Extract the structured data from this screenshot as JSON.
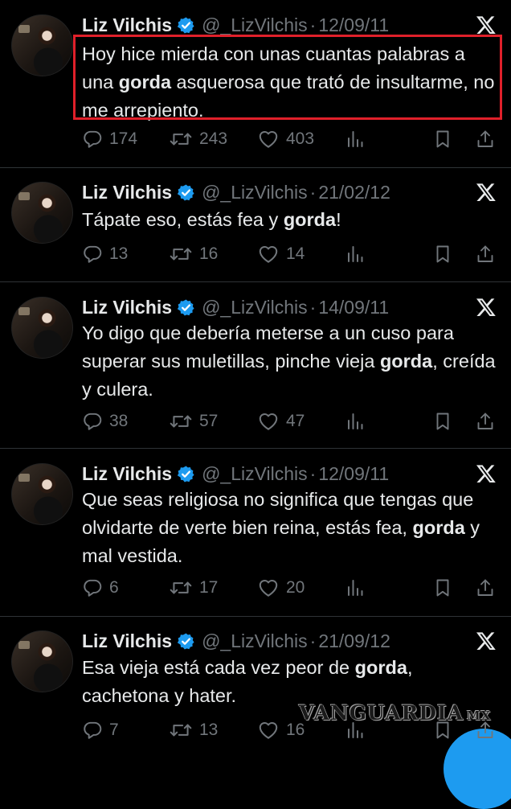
{
  "tweets": [
    {
      "name": "Liz Vilchis",
      "handle": "@_LizVilchis",
      "date": "12/09/11",
      "text": [
        {
          "t": "Hoy hice mierda con unas cuantas palabras a una "
        },
        {
          "t": "gorda",
          "b": true
        },
        {
          "t": " asquerosa que trató de insultarme, no me arrepiento."
        }
      ],
      "highlighted": true,
      "replies": "174",
      "retweets": "243",
      "likes": "403"
    },
    {
      "name": "Liz Vilchis",
      "handle": "@_LizVilchis",
      "date": "21/02/12",
      "text": [
        {
          "t": "Tápate eso, estás fea y "
        },
        {
          "t": "gorda",
          "b": true
        },
        {
          "t": "!"
        }
      ],
      "highlighted": false,
      "replies": "13",
      "retweets": "16",
      "likes": "14"
    },
    {
      "name": "Liz Vilchis",
      "handle": "@_LizVilchis",
      "date": "14/09/11",
      "text": [
        {
          "t": "Yo digo que debería meterse a un cuso para superar sus muletillas, pinche vieja "
        },
        {
          "t": "gorda",
          "b": true
        },
        {
          "t": ", creída y culera."
        }
      ],
      "highlighted": false,
      "replies": "38",
      "retweets": "57",
      "likes": "47"
    },
    {
      "name": "Liz Vilchis",
      "handle": "@_LizVilchis",
      "date": "12/09/11",
      "text": [
        {
          "t": "Que seas religiosa no significa que tengas que olvidarte de verte bien reina, estás fea, "
        },
        {
          "t": "gorda",
          "b": true
        },
        {
          "t": " y mal vestida."
        }
      ],
      "highlighted": false,
      "replies": "6",
      "retweets": "17",
      "likes": "20"
    },
    {
      "name": "Liz Vilchis",
      "handle": "@_LizVilchis",
      "date": "21/09/12",
      "text": [
        {
          "t": "Esa vieja está cada vez peor de "
        },
        {
          "t": "gorda",
          "b": true
        },
        {
          "t": ", cachetona y hater."
        }
      ],
      "highlighted": false,
      "replies": "7",
      "retweets": "13",
      "likes": "16"
    }
  ],
  "separator": "·",
  "watermark": "VANGUARDIA",
  "watermark_suffix": "MX",
  "icons": {
    "reply": "reply-icon",
    "retweet": "retweet-icon",
    "like": "like-icon",
    "views": "views-icon",
    "bookmark": "bookmark-icon",
    "share": "share-icon",
    "x": "x-logo-icon",
    "verified": "verified-badge-icon"
  },
  "colors": {
    "background": "#000000",
    "text": "#e7e9ea",
    "muted": "#71767b",
    "verified": "#1d9bf0",
    "highlight_border": "#e0202a",
    "divider": "#2f3336"
  }
}
